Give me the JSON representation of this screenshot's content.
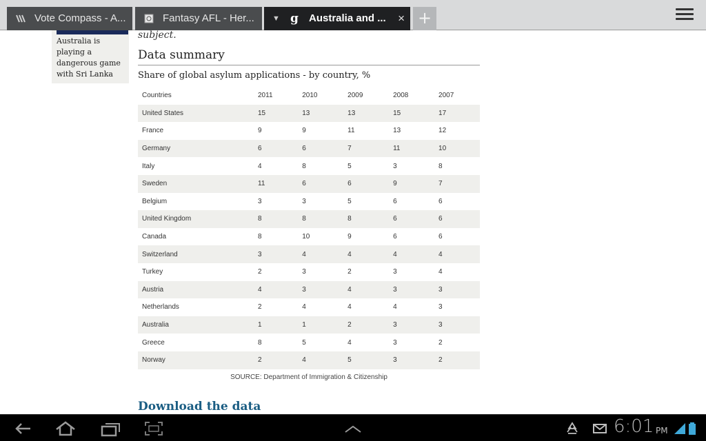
{
  "tabs": [
    {
      "title": "Vote Compass - A...",
      "icon": "vote-compass-icon"
    },
    {
      "title": "Fantasy AFL - Her...",
      "icon": "page-icon"
    },
    {
      "title": "Australia and ...",
      "icon": "guardian-g-icon",
      "favicon_letter": "g",
      "active": true
    }
  ],
  "new_tab_label": "+",
  "close_label": "×",
  "sidebar": {
    "caption": "Australia is playing a dangerous game with Sri Lanka"
  },
  "article": {
    "subject_text": "subject.",
    "section_heading": "Data summary",
    "table_title": "Share of global asylum applications - by country, %",
    "source": "SOURCE: Department of Immigration & Citizenship",
    "download_link": "Download the data"
  },
  "table": {
    "headers": [
      "Countries",
      "2011",
      "2010",
      "2009",
      "2008",
      "2007"
    ],
    "rows": [
      [
        "United States",
        "15",
        "13",
        "13",
        "15",
        "17"
      ],
      [
        "France",
        "9",
        "9",
        "11",
        "13",
        "12"
      ],
      [
        "Germany",
        "6",
        "6",
        "7",
        "11",
        "10"
      ],
      [
        "Italy",
        "4",
        "8",
        "5",
        "3",
        "8"
      ],
      [
        "Sweden",
        "11",
        "6",
        "6",
        "9",
        "7"
      ],
      [
        "Belgium",
        "3",
        "3",
        "5",
        "6",
        "6"
      ],
      [
        "United Kingdom",
        "8",
        "8",
        "8",
        "6",
        "6"
      ],
      [
        "Canada",
        "8",
        "10",
        "9",
        "6",
        "6"
      ],
      [
        "Switzerland",
        "3",
        "4",
        "4",
        "4",
        "4"
      ],
      [
        "Turkey",
        "2",
        "3",
        "2",
        "3",
        "4"
      ],
      [
        "Austria",
        "4",
        "3",
        "4",
        "3",
        "3"
      ],
      [
        "Netherlands",
        "2",
        "4",
        "4",
        "4",
        "3"
      ],
      [
        "Australia",
        "1",
        "1",
        "2",
        "3",
        "3"
      ],
      [
        "Greece",
        "8",
        "5",
        "4",
        "3",
        "2"
      ],
      [
        "Norway",
        "2",
        "4",
        "5",
        "3",
        "2"
      ]
    ]
  },
  "system": {
    "time": "6:01",
    "ampm": "PM"
  },
  "colors": {
    "link": "#1a5d83",
    "row_stripe": "#efefec",
    "active_tab": "#1f2022"
  }
}
